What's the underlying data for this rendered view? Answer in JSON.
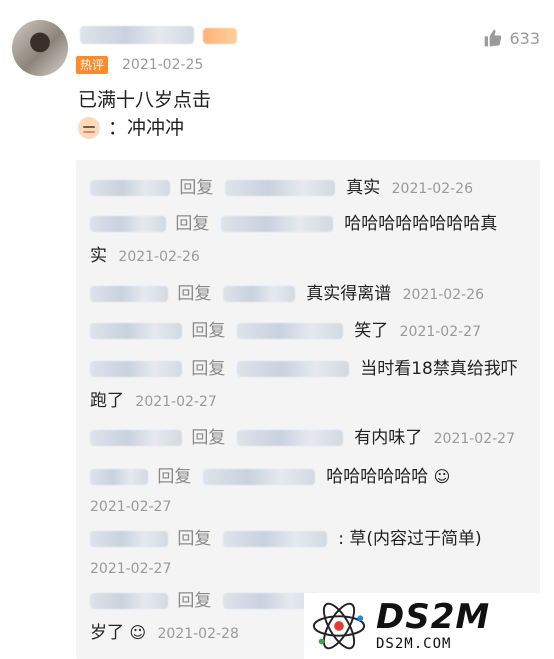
{
  "comment": {
    "hot_badge": "热评",
    "date": "2021-02-25",
    "like_count": "633",
    "text_line1": "已满十八岁点击",
    "text_line2": "：冲冲冲"
  },
  "replies": [
    {
      "reply_word": "回复",
      "text": "真实",
      "date": "2021-02-26"
    },
    {
      "reply_word": "回复",
      "text": "哈哈哈哈哈哈哈哈真",
      "text2": "实",
      "date": "2021-02-26"
    },
    {
      "reply_word": "回复",
      "text": "真实得离谱",
      "date": "2021-02-26"
    },
    {
      "reply_word": "回复",
      "text": "笑了",
      "date": "2021-02-27"
    },
    {
      "reply_word": "回复",
      "text": "当时看18禁真给我吓",
      "text2": "跑了",
      "date": "2021-02-27"
    },
    {
      "reply_word": "回复",
      "text": "有内味了",
      "date": "2021-02-27"
    },
    {
      "reply_word": "回复",
      "text": "哈哈哈哈哈哈",
      "date": "2021-02-27"
    },
    {
      "reply_word": "回复",
      "text": ": 草(内容过于简单)",
      "date": "2021-02-27"
    },
    {
      "reply_word": "回复",
      "text": "岁了",
      "date": "2021-02-28"
    }
  ],
  "watermark": {
    "brand": "DS2M",
    "url": "DS2M.COM"
  },
  "icons": {
    "like": "thumbs-up-icon",
    "laugh": "laughing-face-icon",
    "baby": "baby-face-icon"
  }
}
